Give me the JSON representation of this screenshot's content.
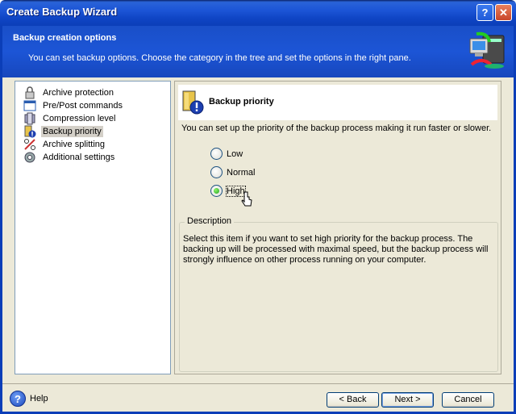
{
  "window": {
    "title": "Create Backup Wizard",
    "help_btn": "?",
    "close_btn": "✕"
  },
  "header": {
    "title": "Backup creation options",
    "subtitle": "You can set backup options. Choose the category in the tree and set the options in the right pane."
  },
  "tree": {
    "items": [
      {
        "label": "Archive protection",
        "icon": "lock-icon"
      },
      {
        "label": "Pre/Post commands",
        "icon": "window-icon"
      },
      {
        "label": "Compression level",
        "icon": "compression-icon"
      },
      {
        "label": "Backup priority",
        "icon": "priority-icon",
        "selected": true
      },
      {
        "label": "Archive splitting",
        "icon": "splitting-icon"
      },
      {
        "label": "Additional settings",
        "icon": "settings-icon"
      }
    ]
  },
  "pane": {
    "title": "Backup priority",
    "intro": "You can set up the priority of the backup process making it run faster or slower.",
    "options": [
      {
        "label": "Low",
        "checked": false
      },
      {
        "label": "Normal",
        "checked": false
      },
      {
        "label": "High",
        "checked": true
      }
    ],
    "description_legend": "Description",
    "description_text": "Select this item if you want to set high priority for the backup process. The backing up will be processed with maximal speed, but the backup process will strongly influence on other process running on your computer."
  },
  "footer": {
    "help": "Help",
    "back": "< Back",
    "next": "Next >",
    "cancel": "Cancel"
  },
  "colors": {
    "xp_blue": "#1c55d6",
    "radio_green": "#21a121"
  }
}
